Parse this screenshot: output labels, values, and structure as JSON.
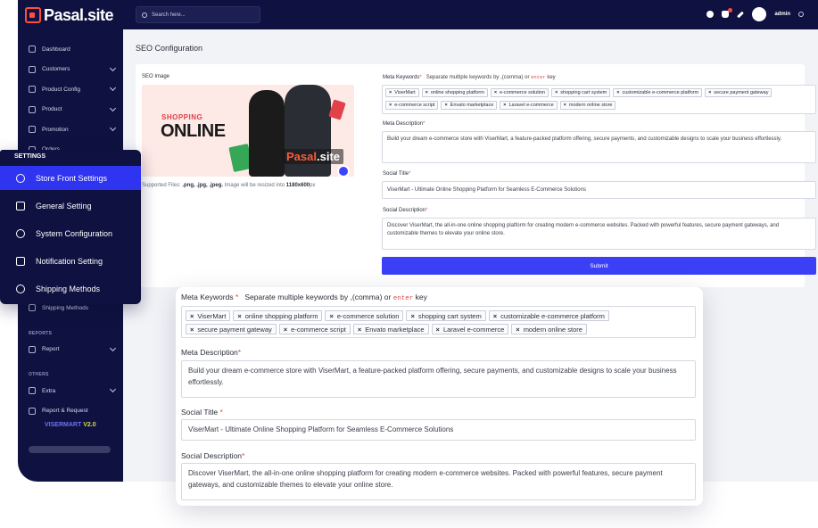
{
  "brand": {
    "name": "Pasal.site",
    "version_label": "VISERMART",
    "version_number": "V2.0"
  },
  "topbar": {
    "search_placeholder": "Search here...",
    "user": "admin"
  },
  "sidebar": {
    "items": [
      {
        "label": "Dashboard",
        "icon": "home-icon",
        "chevron": false
      },
      {
        "label": "Customers",
        "icon": "users-icon",
        "chevron": true
      },
      {
        "label": "Product Config",
        "icon": "box-icon",
        "chevron": true
      },
      {
        "label": "Product",
        "icon": "tag-icon",
        "chevron": true
      },
      {
        "label": "Promotion",
        "icon": "megaphone-icon",
        "chevron": true
      },
      {
        "label": "Orders",
        "icon": "cart-icon",
        "chevron": false
      }
    ],
    "lower_items": [
      {
        "label": "Shipping Methods",
        "icon": "truck-icon"
      }
    ],
    "sections": [
      {
        "title": "REPORTS",
        "items": [
          {
            "label": "Report",
            "icon": "chart-icon",
            "chevron": true
          }
        ]
      },
      {
        "title": "OTHERS",
        "items": [
          {
            "label": "Extra",
            "icon": "grid-icon",
            "chevron": true
          },
          {
            "label": "Report & Request",
            "icon": "bug-icon",
            "chevron": false
          }
        ]
      }
    ]
  },
  "settings_panel": {
    "title": "SETTINGS",
    "items": [
      {
        "label": "Store Front Settings",
        "icon": "store-icon",
        "active": true
      },
      {
        "label": "General Setting",
        "icon": "gear-icon",
        "active": false
      },
      {
        "label": "System Configuration",
        "icon": "tools-icon",
        "active": false
      },
      {
        "label": "Notification Setting",
        "icon": "bell-icon",
        "active": false
      },
      {
        "label": "Shipping Methods",
        "icon": "truck-icon",
        "active": false
      }
    ]
  },
  "page": {
    "title": "SEO Configuration",
    "seo_image_label": "SEO Image",
    "image_banner": {
      "line1": "SHOPPING",
      "line2": "ONLINE",
      "brand_a": "Pasal",
      "brand_b": ".site"
    },
    "supported_prefix": "Supported Files:",
    "supported_types": ".png, .jpg, .jpeg.",
    "supported_suffix": "Image will be resized into",
    "supported_size": "1180x600",
    "supported_unit": "px",
    "meta_keywords_label": "Meta Keywords",
    "meta_keywords_hint_a": "Separate multiple keywords by",
    "meta_keywords_hint_b": ",(comma) or",
    "meta_keywords_hint_code": "enter",
    "meta_keywords_hint_c": "key",
    "keywords": [
      "ViserMart",
      "online shopping platform",
      "e-commerce solution",
      "shopping cart system",
      "customizable e-commerce platform",
      "secure payment gateway",
      "e-commerce script",
      "Envato marketplace",
      "Laravel e-commerce",
      "modern online store"
    ],
    "meta_description_label": "Meta Description",
    "meta_description": "Build your dream e-commerce store with ViserMart, a feature-packed platform offering, secure payments, and customizable designs to scale your business effortlessly.",
    "social_title_label": "Social Title",
    "social_title": "ViserMart - Ultimate Online Shopping Platform for Seamless E-Commerce Solutions",
    "social_description_label": "Social Description",
    "social_description": "Discover ViserMart, the all-in-one online shopping platform for creating modern e-commerce websites. Packed with powerful features, secure payment gateways, and customizable themes to elevate your online store.",
    "submit_label": "Submit",
    "required_mark": "*"
  },
  "colors": {
    "sidebar": "#0f1240",
    "accent": "#3b3ff5",
    "required": "#e34545",
    "brand": "#ff4d3d"
  }
}
